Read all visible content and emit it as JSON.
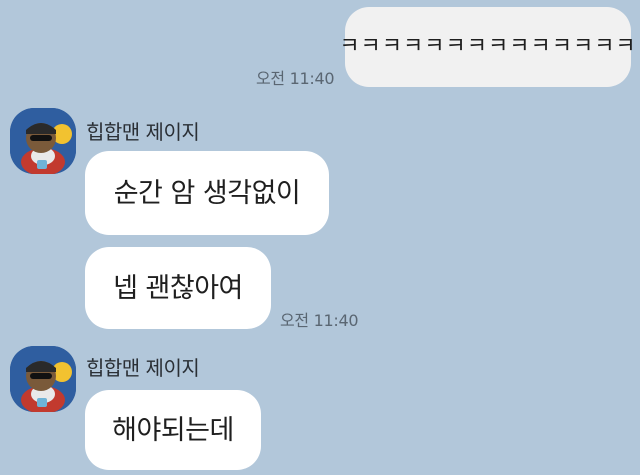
{
  "messages": [
    {
      "side": "mine",
      "text": "ㅋㅋㅋㅋㅋㅋㅋㅋㅋㅋㅋㅋㅋㅋ",
      "time": "오전 11:40"
    },
    {
      "side": "theirs",
      "sender": "힙합맨 제이지",
      "avatar": "hiphop-character-avatar",
      "text": "순간 암 생각없이"
    },
    {
      "side": "theirs",
      "text": "넵 괜찮아여",
      "time": "오전 11:40"
    },
    {
      "side": "theirs",
      "sender": "힙합맨 제이지",
      "avatar": "hiphop-character-avatar",
      "text": "해야되는데"
    }
  ],
  "colors": {
    "background": "#b2c7da",
    "my_bubble": "#f1f1f1",
    "their_bubble": "#ffffff",
    "avatar_bg": "#2f5ea0"
  }
}
